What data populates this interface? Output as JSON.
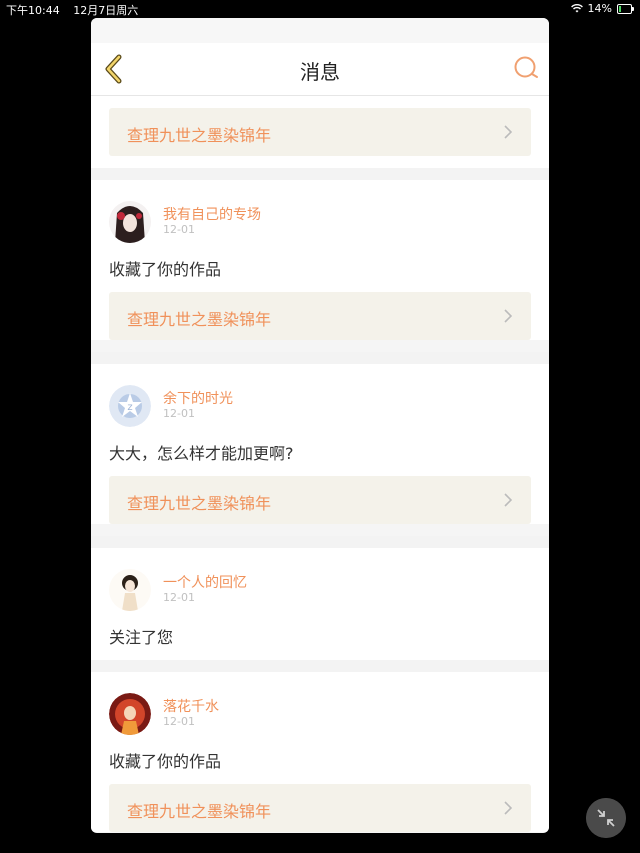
{
  "status": {
    "time": "下午10:44",
    "date": "12月7日周六",
    "battery": "14%"
  },
  "nav": {
    "title": "消息"
  },
  "first_link": "查理九世之墨染锦年",
  "items": [
    {
      "user": "我有自己的专场",
      "date": "12-01",
      "message": "收藏了你的作品",
      "link": "查理九世之墨染锦年"
    },
    {
      "user": "余下的时光",
      "date": "12-01",
      "message": "大大，怎么样才能加更啊?",
      "link": "查理九世之墨染锦年"
    },
    {
      "user": "一个人的回忆",
      "date": "12-01",
      "message": "关注了您"
    },
    {
      "user": "落花千水",
      "date": "12-01",
      "message": "收藏了你的作品",
      "link": "查理九世之墨染锦年"
    }
  ]
}
